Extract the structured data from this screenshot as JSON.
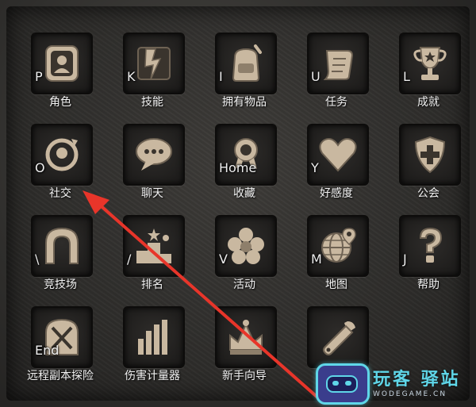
{
  "menu": {
    "items": [
      {
        "key": "P",
        "label": "角色",
        "icon": "portrait-icon"
      },
      {
        "key": "K",
        "label": "技能",
        "icon": "lightning-icon"
      },
      {
        "key": "I",
        "label": "拥有物品",
        "icon": "backpack-icon"
      },
      {
        "key": "U",
        "label": "任务",
        "icon": "scroll-icon"
      },
      {
        "key": "L",
        "label": "成就",
        "icon": "trophy-icon"
      },
      {
        "key": "O",
        "label": "社交",
        "icon": "social-icon"
      },
      {
        "key": "",
        "label": "聊天",
        "icon": "chat-bubble-icon"
      },
      {
        "key": "Home",
        "label": "收藏",
        "icon": "medal-icon"
      },
      {
        "key": "Y",
        "label": "好感度",
        "icon": "heart-icon"
      },
      {
        "key": "",
        "label": "公会",
        "icon": "shield-icon"
      },
      {
        "key": "\\",
        "label": "竞技场",
        "icon": "arena-gate-icon"
      },
      {
        "key": "/",
        "label": "排名",
        "icon": "ranking-podium-icon"
      },
      {
        "key": "V",
        "label": "活动",
        "icon": "flower-icon"
      },
      {
        "key": "M",
        "label": "地图",
        "icon": "globe-icon"
      },
      {
        "key": "J",
        "label": "帮助",
        "icon": "question-mark-icon"
      },
      {
        "key": "End",
        "label": "远程副本探险",
        "icon": "crossed-swords-gate-icon"
      },
      {
        "key": "",
        "label": "伤害计量器",
        "icon": "bar-chart-icon"
      },
      {
        "key": "",
        "label": "新手向导",
        "icon": "crown-icon"
      },
      {
        "key": "",
        "label": "",
        "icon": "wrench-icon"
      }
    ]
  },
  "watermark": {
    "title": "玩客 驿站",
    "subtitle": "WODEGAME.CN"
  },
  "colors": {
    "icon_fill": "#c9b8a0",
    "icon_shadow": "#6e6253",
    "arrow": "#e8352a",
    "watermark_accent": "#5fd6e8"
  }
}
